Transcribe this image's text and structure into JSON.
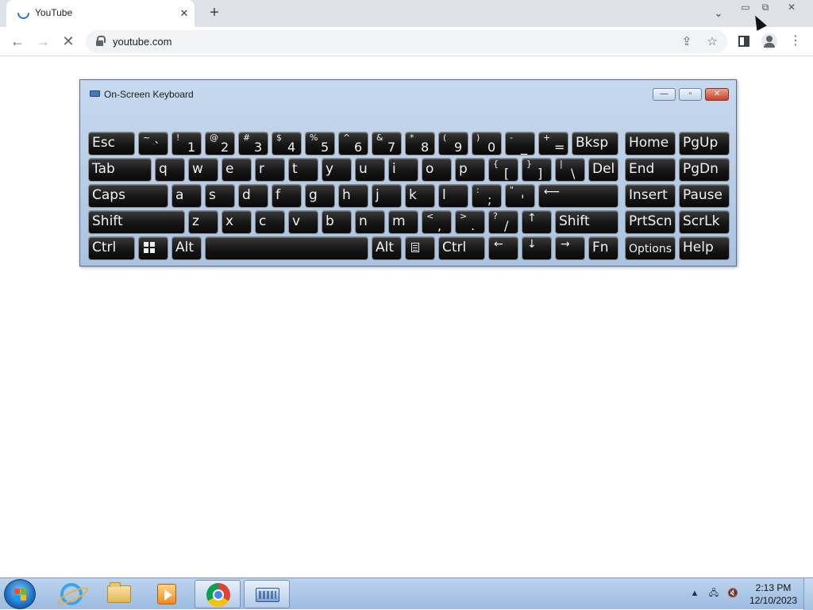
{
  "browser": {
    "tab_title": "YouTube",
    "tab_close": "✕",
    "new_tab": "+",
    "tab_search": "⌄",
    "win_min": "▭",
    "win_restore": "⧉",
    "win_close": "✕",
    "url": "youtube.com",
    "back": "←",
    "forward": "→",
    "stop": "✕",
    "share": "⇪",
    "bookmark": "☆",
    "menu": "⋮"
  },
  "osk": {
    "title": "On-Screen Keyboard",
    "min": "—",
    "max": "▫",
    "close": "✕",
    "rows": [
      [
        {
          "label": "Esc"
        },
        {
          "shift": "~",
          "main": "`"
        },
        {
          "shift": "!",
          "main": "1"
        },
        {
          "shift": "@",
          "main": "2"
        },
        {
          "shift": "#",
          "main": "3"
        },
        {
          "shift": "$",
          "main": "4"
        },
        {
          "shift": "%",
          "main": "5"
        },
        {
          "shift": "^",
          "main": "6"
        },
        {
          "shift": "&",
          "main": "7"
        },
        {
          "shift": "*",
          "main": "8"
        },
        {
          "shift": "(",
          "main": "9"
        },
        {
          "shift": ")",
          "main": "0"
        },
        {
          "shift": "-",
          "main": "_"
        },
        {
          "shift": "+",
          "main": "="
        },
        {
          "label": "Bksp"
        },
        {
          "label": "Home"
        },
        {
          "label": "PgUp"
        }
      ],
      [
        {
          "label": "Tab"
        },
        {
          "label": "q"
        },
        {
          "label": "w"
        },
        {
          "label": "e"
        },
        {
          "label": "r"
        },
        {
          "label": "t"
        },
        {
          "label": "y"
        },
        {
          "label": "u"
        },
        {
          "label": "i"
        },
        {
          "label": "o"
        },
        {
          "label": "p"
        },
        {
          "shift": "{",
          "main": "["
        },
        {
          "shift": "}",
          "main": "]"
        },
        {
          "shift": "|",
          "main": "\\"
        },
        {
          "label": "Del"
        },
        {
          "label": "End"
        },
        {
          "label": "PgDn"
        }
      ],
      [
        {
          "label": "Caps"
        },
        {
          "label": "a"
        },
        {
          "label": "s"
        },
        {
          "label": "d"
        },
        {
          "label": "f"
        },
        {
          "label": "g"
        },
        {
          "label": "h"
        },
        {
          "label": "j"
        },
        {
          "label": "k"
        },
        {
          "label": "l"
        },
        {
          "shift": ":",
          "main": ";"
        },
        {
          "shift": "\"",
          "main": "'"
        },
        {
          "arrow": "⟵"
        },
        {
          "label": "Insert"
        },
        {
          "label": "Pause"
        }
      ],
      [
        {
          "label": "Shift"
        },
        {
          "label": "z"
        },
        {
          "label": "x"
        },
        {
          "label": "c"
        },
        {
          "label": "v"
        },
        {
          "label": "b"
        },
        {
          "label": "n"
        },
        {
          "label": "m"
        },
        {
          "shift": "<",
          "main": ","
        },
        {
          "shift": ">",
          "main": "."
        },
        {
          "shift": "?",
          "main": "/"
        },
        {
          "arrow": "↑"
        },
        {
          "label": "Shift"
        },
        {
          "label": "PrtScn"
        },
        {
          "label": "ScrLk"
        }
      ],
      [
        {
          "label": "Ctrl"
        },
        {
          "icon": "windows-logo-icon"
        },
        {
          "label": "Alt"
        },
        {
          "label": ""
        },
        {
          "label": "Alt"
        },
        {
          "icon": "menu-icon"
        },
        {
          "label": "Ctrl"
        },
        {
          "arrow": "←"
        },
        {
          "arrow": "↓"
        },
        {
          "arrow": "→"
        },
        {
          "label": "Fn"
        },
        {
          "label": "Options",
          "small": true
        },
        {
          "label": "Help"
        }
      ]
    ]
  },
  "taskbar": {
    "apps": [
      "internet-explorer-icon",
      "file-explorer-icon",
      "media-player-icon",
      "chrome-icon",
      "on-screen-keyboard-icon"
    ],
    "tray_expand": "▲",
    "tray_network": "🖧",
    "tray_volume": "🔇",
    "time": "2:13 PM",
    "date": "12/10/2023"
  }
}
